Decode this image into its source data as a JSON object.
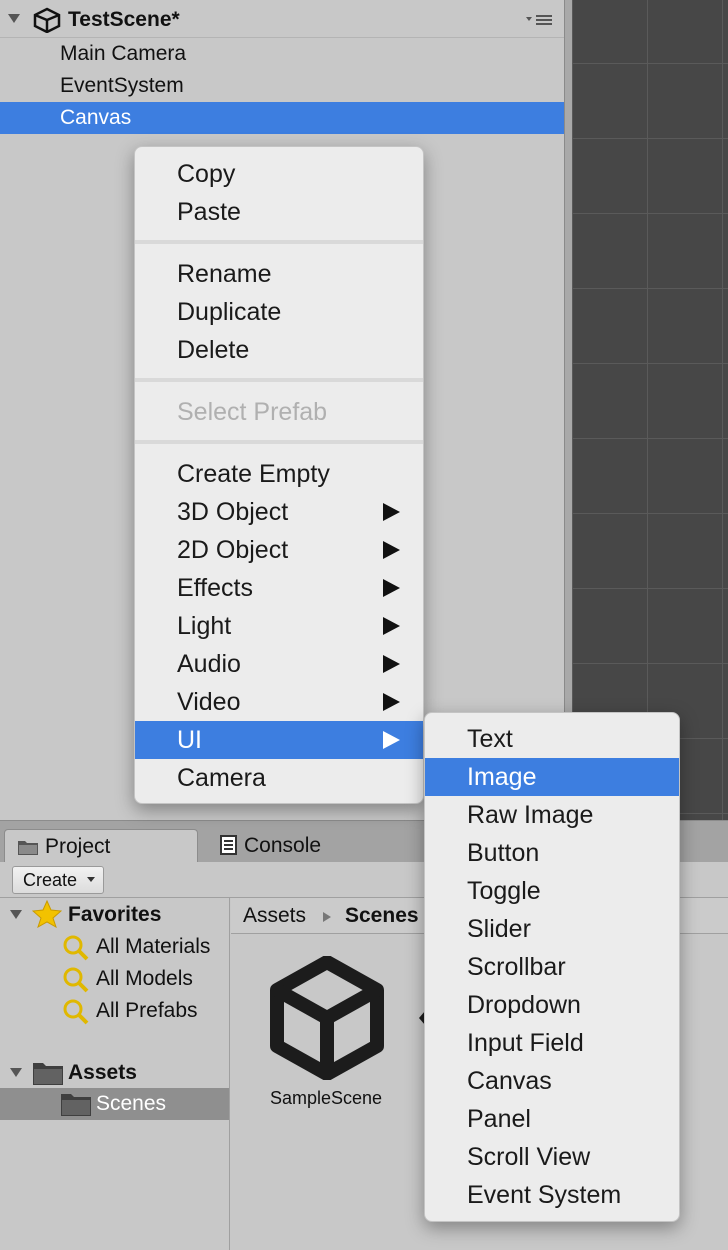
{
  "hierarchy": {
    "scene_title": "TestScene*",
    "items": [
      {
        "label": "Main Camera",
        "selected": false
      },
      {
        "label": "EventSystem",
        "selected": false
      },
      {
        "label": "Canvas",
        "selected": true
      }
    ]
  },
  "context_menu": {
    "items": [
      {
        "label": "Copy",
        "enabled": true
      },
      {
        "label": "Paste",
        "enabled": true
      },
      {
        "label": "Rename",
        "enabled": true
      },
      {
        "label": "Duplicate",
        "enabled": true
      },
      {
        "label": "Delete",
        "enabled": true
      },
      {
        "label": "Select Prefab",
        "enabled": false
      },
      {
        "label": "Create Empty",
        "enabled": true
      },
      {
        "label": "3D Object",
        "enabled": true,
        "submenu": true
      },
      {
        "label": "2D Object",
        "enabled": true,
        "submenu": true
      },
      {
        "label": "Effects",
        "enabled": true,
        "submenu": true
      },
      {
        "label": "Light",
        "enabled": true,
        "submenu": true
      },
      {
        "label": "Audio",
        "enabled": true,
        "submenu": true
      },
      {
        "label": "Video",
        "enabled": true,
        "submenu": true
      },
      {
        "label": "UI",
        "enabled": true,
        "submenu": true,
        "highlighted": true
      },
      {
        "label": "Camera",
        "enabled": true
      }
    ]
  },
  "ui_submenu": {
    "items": [
      {
        "label": "Text"
      },
      {
        "label": "Image",
        "highlighted": true
      },
      {
        "label": "Raw Image"
      },
      {
        "label": "Button"
      },
      {
        "label": "Toggle"
      },
      {
        "label": "Slider"
      },
      {
        "label": "Scrollbar"
      },
      {
        "label": "Dropdown"
      },
      {
        "label": "Input Field"
      },
      {
        "label": "Canvas"
      },
      {
        "label": "Panel"
      },
      {
        "label": "Scroll View"
      },
      {
        "label": "Event System"
      }
    ]
  },
  "bottom_panel": {
    "tabs": [
      {
        "label": "Project",
        "active": true,
        "icon": "folder-icon"
      },
      {
        "label": "Console",
        "active": false,
        "icon": "console-icon"
      }
    ],
    "create_label": "Create",
    "tree": {
      "favorites_label": "Favorites",
      "favorites": [
        "All Materials",
        "All Models",
        "All Prefabs"
      ],
      "assets_label": "Assets",
      "scenes_label": "Scenes"
    },
    "breadcrumb": {
      "root": "Assets",
      "current": "Scenes"
    },
    "asset": {
      "label": "SampleScene",
      "icon": "unity-scene-icon"
    }
  },
  "colors": {
    "selection": "#3d7ee0",
    "panel": "#c8c8c8",
    "scene_bg": "#474747",
    "menu_bg": "#ececec"
  }
}
